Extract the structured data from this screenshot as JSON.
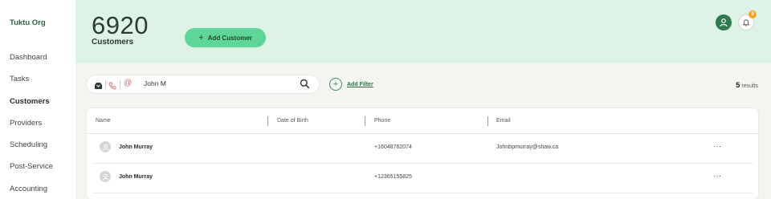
{
  "sidebar": {
    "org_name": "Tuktu Org",
    "items": [
      {
        "label": "Dashboard"
      },
      {
        "label": "Tasks"
      },
      {
        "label": "Customers"
      },
      {
        "label": "Providers"
      },
      {
        "label": "Scheduling"
      },
      {
        "label": "Post-Service"
      },
      {
        "label": "Accounting"
      }
    ],
    "active": "Customers"
  },
  "header": {
    "count": "6920",
    "count_label": "Customers",
    "add_button_label": "Add Customer",
    "user_initial_icon": "user-icon",
    "notification_count": "0"
  },
  "search": {
    "value": "John M",
    "icons": [
      "inbox-icon",
      "phone-icon",
      "at-icon"
    ],
    "search_icon": "search-icon"
  },
  "filter": {
    "label": "Add Filter"
  },
  "results": {
    "count": "5",
    "label": "results"
  },
  "table": {
    "columns": [
      "Name",
      "Date of Birth",
      "Phone",
      "Email"
    ],
    "rows": [
      {
        "name": "John Murray",
        "dob": "",
        "phone": "+16048762074",
        "email": "Johnbpmurray@shaw.ca",
        "more": "···"
      },
      {
        "name": "John Murray",
        "dob": "",
        "phone": "+12365155825",
        "email": "",
        "more": "···"
      }
    ]
  },
  "colors": {
    "header_bg": "#dcf3e6",
    "accent": "#5fd697",
    "brand_dark": "#2f7a4e",
    "badge": "#f5a623"
  }
}
